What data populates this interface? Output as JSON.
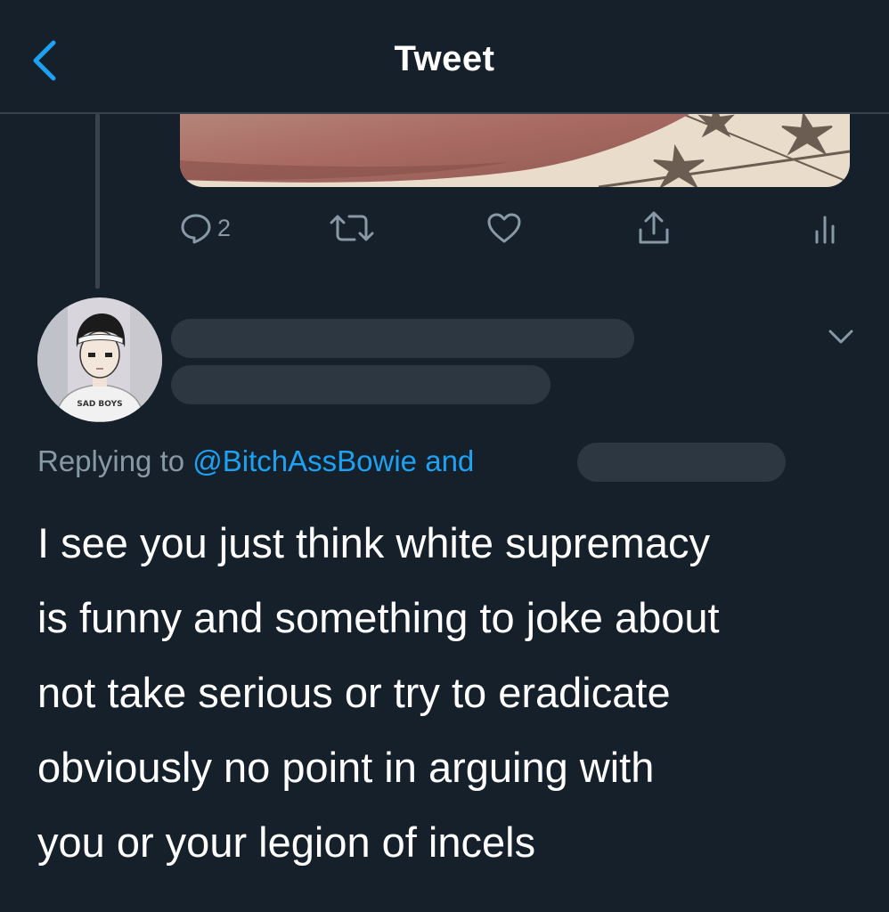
{
  "header": {
    "title": "Tweet"
  },
  "actions": {
    "reply_count": "2"
  },
  "reply": {
    "replying_prefix": "Replying to",
    "mention": "@BitchAssBowie",
    "and_word": "and",
    "text_lines": [
      "I see you just think white supremacy",
      "is funny and something to joke about",
      "not take serious or try to eradicate",
      "obviously no point in arguing with",
      "you or your legion of incels"
    ]
  },
  "avatar": {
    "shirt_text": "SAD BOYS"
  },
  "colors": {
    "background": "#15202b",
    "accent": "#1da1f2",
    "muted": "#8899a6",
    "divider": "#38444d",
    "redaction": "#2d3741"
  }
}
